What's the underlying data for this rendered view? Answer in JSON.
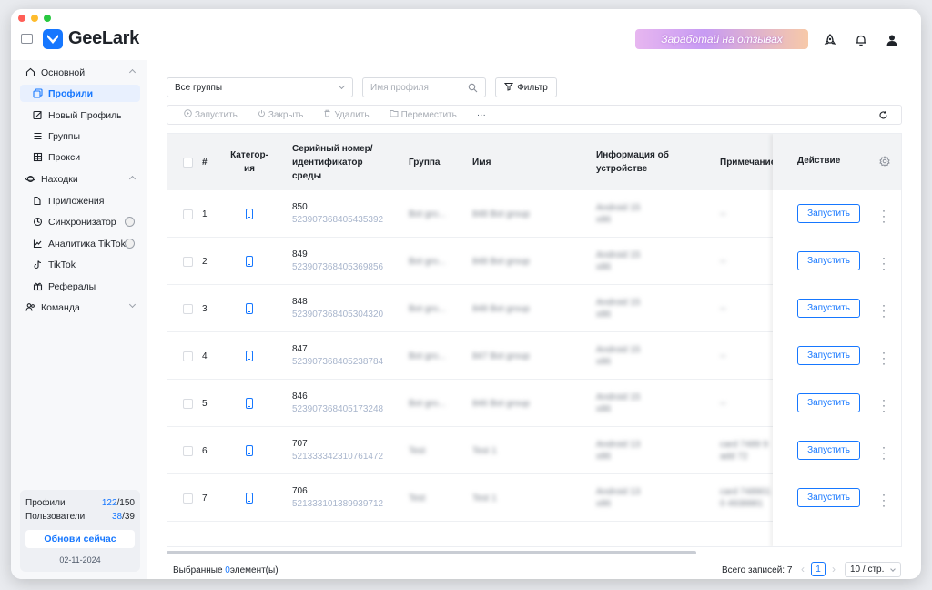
{
  "app": {
    "name": "GeeLark",
    "promo": "Заработай на отзывах"
  },
  "sidebar": {
    "sections": [
      {
        "label": "Основной"
      },
      {
        "label": "Находки"
      },
      {
        "label": "Команда"
      }
    ],
    "items": [
      {
        "label": "Профили",
        "icon": "profiles-icon",
        "active": true
      },
      {
        "label": "Новый Профиль",
        "icon": "new-profile-icon"
      },
      {
        "label": "Группы",
        "icon": "groups-icon"
      },
      {
        "label": "Прокси",
        "icon": "proxy-icon"
      },
      {
        "label": "Приложения",
        "icon": "apps-icon"
      },
      {
        "label": "Синхронизатор",
        "icon": "sync-icon"
      },
      {
        "label": "Аналитика TikTok",
        "icon": "analytics-icon"
      },
      {
        "label": "TikTok",
        "icon": "tiktok-icon"
      },
      {
        "label": "Рефералы",
        "icon": "gift-icon"
      }
    ],
    "stats": {
      "profiles_label": "Профили",
      "profiles_used": "122",
      "profiles_total": "/150",
      "users_label": "Пользователи",
      "users_used": "38",
      "users_total": "/39",
      "update_label": "Обнови сейчас",
      "date": "02-11-2024"
    }
  },
  "filters": {
    "group_select": "Все группы",
    "search_placeholder": "Имя профиля",
    "filter_label": "Фильтр"
  },
  "toolbar": {
    "launch": "Запустить",
    "close": "Закрыть",
    "delete": "Удалить",
    "move": "Переместить",
    "more": "···"
  },
  "table": {
    "headers": {
      "num": "#",
      "category": "Категор­ия",
      "serial": "Серийный номер/ идентификатор среды",
      "group": "Группа",
      "name": "Имя",
      "device": "Информация об устройстве",
      "note": "Примечание",
      "action": "Действие"
    },
    "rows": [
      {
        "num": "1",
        "serial": "850",
        "env_id": "523907368405435392",
        "group": "Bot gro...",
        "name": "848 Bot group",
        "device": "Android 15 x86",
        "note": "--"
      },
      {
        "num": "2",
        "serial": "849",
        "env_id": "523907368405369856",
        "group": "Bot gro...",
        "name": "848 Bot group",
        "device": "Android 15 x86",
        "note": "--"
      },
      {
        "num": "3",
        "serial": "848",
        "env_id": "523907368405304320",
        "group": "Bot gro...",
        "name": "848 Bot group",
        "device": "Android 15 x86",
        "note": "--"
      },
      {
        "num": "4",
        "serial": "847",
        "env_id": "523907368405238784",
        "group": "Bot gro...",
        "name": "847 Bot group",
        "device": "Android 15 x86",
        "note": "--"
      },
      {
        "num": "5",
        "serial": "846",
        "env_id": "523907368405173248",
        "group": "Bot gro...",
        "name": "846 Bot group",
        "device": "Android 15 x86",
        "note": "--"
      },
      {
        "num": "6",
        "serial": "707",
        "env_id": "521333342310761472",
        "group": "Test",
        "name": "Test 1",
        "device": "Android 13 x86",
        "note": "card 7489 9 add 72"
      },
      {
        "num": "7",
        "serial": "706",
        "env_id": "521333101389939712",
        "group": "Test",
        "name": "Test 1",
        "device": "Android 13 x86",
        "note": "card 748901 0 4938881"
      }
    ],
    "launch_label": "Запустить"
  },
  "footer": {
    "selected_prefix": "Выбранные",
    "selected_count": "0",
    "selected_suffix": "элемент(ы)",
    "total": "Всего записей: 7",
    "page": "1",
    "per_page": "10 / стр."
  },
  "colors": {
    "accent": "#1677ff"
  }
}
